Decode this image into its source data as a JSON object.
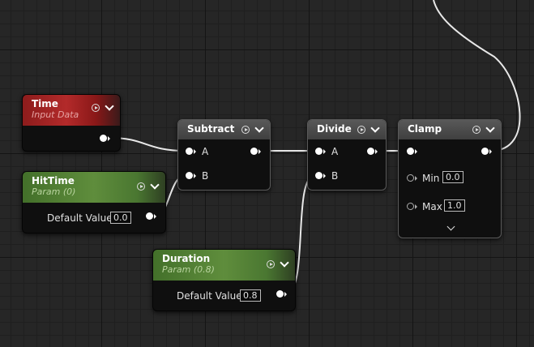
{
  "nodes": {
    "time": {
      "title": "Time",
      "subtitle": "Input Data"
    },
    "hittime": {
      "title": "HitTime",
      "subtitle": "Param (0)",
      "default_label": "Default Value",
      "default_value": "0.0"
    },
    "duration": {
      "title": "Duration",
      "subtitle": "Param (0.8)",
      "default_label": "Default Value",
      "default_value": "0.8"
    },
    "subtract": {
      "title": "Subtract",
      "pin_a": "A",
      "pin_b": "B"
    },
    "divide": {
      "title": "Divide",
      "pin_a": "A",
      "pin_b": "B"
    },
    "clamp": {
      "title": "Clamp",
      "min_label": "Min",
      "min_value": "0.0",
      "max_label": "Max",
      "max_value": "1.0"
    }
  },
  "colors": {
    "input_header": "#a32323",
    "param_header": "#5a8a3a",
    "operator_header": "#4a4a4a",
    "wire": "#e8e8e8"
  },
  "icons": [
    "play-circle-icon",
    "chevron-down-icon"
  ]
}
